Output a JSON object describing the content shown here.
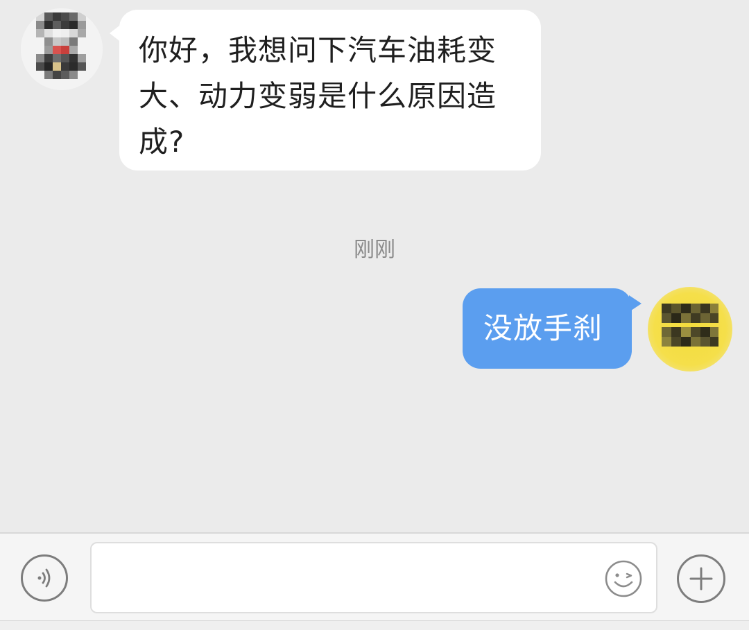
{
  "chat": {
    "messages": [
      {
        "side": "left",
        "lines": [
          "你好，我想问下汽车油耗变",
          "大、动力变弱是什么原因造",
          "成?"
        ]
      },
      {
        "side": "right",
        "text": "没放手刹"
      }
    ],
    "timestamp": "刚刚"
  },
  "input_bar": {
    "voice_icon": "voice-icon",
    "emoji_icon": "emoji-icon",
    "plus_icon": "plus-icon",
    "input_value": ""
  },
  "colors": {
    "background": "#ebebeb",
    "incoming_bubble": "#ffffff",
    "outgoing_bubble": "#5b9eef",
    "timestamp_text": "#8a8a8a",
    "avatar_right": "#f3dc3c"
  }
}
